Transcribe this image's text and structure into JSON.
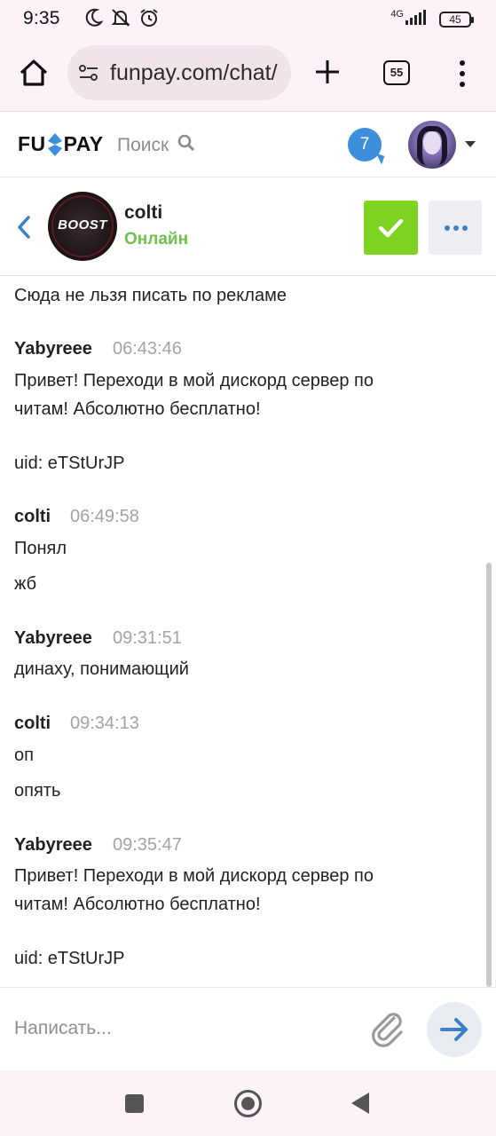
{
  "status_bar": {
    "time": "9:35",
    "network": "4G",
    "battery": "45",
    "left_icons": [
      "moon-icon",
      "muted-bell-icon",
      "alarm-icon"
    ],
    "right_icons": [
      "signal-icon",
      "battery-icon"
    ]
  },
  "browser": {
    "url": "funpay.com/chat/",
    "tab_count": "55",
    "icons": [
      "home-icon",
      "site-settings-icon",
      "new-tab-icon",
      "tabs-icon",
      "menu-icon"
    ]
  },
  "site_header": {
    "logo": {
      "left": "FU",
      "right": "PAY"
    },
    "search_label": "Поиск",
    "notification_count": "7"
  },
  "chat_header": {
    "contact_name": "colti",
    "contact_status": "Онлайн",
    "avatar_text": "BOOST"
  },
  "messages": {
    "partial_top_text": "Сюда не льзя писать по рекламе",
    "groups": [
      {
        "author": "Yabyreee",
        "time": "06:43:46",
        "lines": [
          "Привет! Переходи в мой дискорд сервер по",
          "читам! Абсолютно бесплатно!",
          "uid: eTStUrJP"
        ]
      },
      {
        "author": "colti",
        "time": "06:49:58",
        "lines": [
          "Понял",
          "жб"
        ]
      },
      {
        "author": "Yabyreee",
        "time": "09:31:51",
        "lines": [
          "динаху, понимающий"
        ]
      },
      {
        "author": "colti",
        "time": "09:34:13",
        "lines": [
          "оп",
          "опять"
        ]
      },
      {
        "author": "Yabyreee",
        "time": "09:35:47",
        "lines": [
          "Привет! Переходи в мой дискорд сервер по",
          "читам! Абсолютно бесплатно!",
          "uid: eTStUrJP"
        ]
      }
    ]
  },
  "composer": {
    "placeholder": "Написать..."
  },
  "colors": {
    "online_green": "#6cc24a",
    "check_green": "#7ed321",
    "accent_blue": "#3d8fdb"
  }
}
